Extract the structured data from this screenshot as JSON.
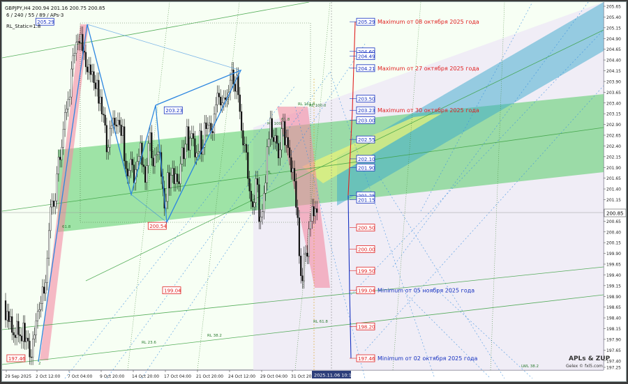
{
  "header": {
    "symbol_line": "GBPJPY,H4  200.94 201.16 200.75 200.85",
    "settings_line": "6 / 240 / 55 / 89 / APs-3",
    "indicator_label": "RL_Static=1.8"
  },
  "watermark": {
    "line1": "APLs & ZUP",
    "line2": "Gelex © fxl5.com"
  },
  "current_price_label": "200.85",
  "current_time_label": "2025.11.06 10:12",
  "colors": {
    "background": "#f7fff4",
    "bull_candle": "#111111",
    "bear_candle": "#111111",
    "green_channel": "#55cc66",
    "blue_channel": "#39aacc",
    "pink_band": "#f48aa4",
    "lavender_zone": "#ece6f6",
    "red_target": "#e02020",
    "blue_target": "#1530c0",
    "pattern_line": "#2c86e0"
  },
  "chart_data": {
    "type": "candlestick",
    "symbol": "GBPJPY",
    "timeframe": "H4",
    "ylim": [
      197.25,
      205.65
    ],
    "y_ticks": [
      "205.65",
      "205.40",
      "205.15",
      "204.90",
      "204.65",
      "204.40",
      "204.15",
      "203.90",
      "203.65",
      "203.40",
      "203.15",
      "202.90",
      "202.65",
      "202.40",
      "202.15",
      "201.90",
      "201.65",
      "201.40",
      "201.15",
      "200.90",
      "200.65",
      "200.40",
      "200.15",
      "199.90",
      "199.65",
      "199.40",
      "199.15",
      "198.90",
      "198.65",
      "198.40",
      "198.15",
      "197.90",
      "197.65",
      "197.40",
      "197.25"
    ],
    "x_ticks": [
      "29 Sep 2025",
      "2 Oct 12:00",
      "7 Oct 04:00",
      "9 Oct 20:00",
      "14 Oct 20:00",
      "17 Oct 04:00",
      "21 Oct 20:00",
      "24 Oct 12:00",
      "29 Oct 04:00",
      "31 Oct 20:00"
    ],
    "ohlc": {
      "open": [
        198.8,
        198.35,
        198.55,
        198.31,
        198.43,
        198.06,
        198.0,
        197.94,
        198.32,
        198.01,
        197.98,
        197.86,
        198.28,
        197.84,
        197.93,
        197.86,
        197.49,
        197.48,
        197.91,
        198.0,
        198.33,
        198.55,
        198.59,
        198.73,
        199.12,
        198.97,
        199.22,
        199.79,
        200.43,
        200.98,
        201.12,
        200.99,
        201.12,
        201.75,
        202.14,
        202.08,
        202.37,
        202.79,
        203.18,
        203.26,
        203.49,
        203.54,
        204.19,
        204.5,
        204.56,
        204.81,
        204.83,
        204.8,
        205.0,
        204.61,
        204.58,
        204.24,
        204.12,
        204.29,
        204.06,
        204.13,
        203.87,
        203.73,
        203.93,
        203.39,
        203.54,
        203.14,
        203.12,
        202.88,
        202.26,
        202.37,
        202.81,
        202.87,
        203.05,
        202.89,
        202.86,
        203.0,
        202.89,
        202.64,
        202.85,
        202.05,
        201.87,
        201.7,
        201.83,
        202.09,
        201.96,
        201.54,
        201.85,
        202.04,
        202.16,
        202.47,
        201.96,
        201.92,
        201.55,
        201.94,
        202.46,
        202.71,
        202.12,
        201.93,
        202.18,
        202.2,
        202.26,
        202.25,
        201.69,
        201.41,
        200.95,
        201.11,
        201.78,
        201.42,
        201.72,
        201.88,
        201.52,
        201.75,
        201.57,
        201.52,
        201.98,
        202.36,
        202.1,
        202.44,
        202.85,
        202.3,
        202.58,
        202.69,
        202.57,
        202.14,
        202.24,
        202.27,
        202.75,
        202.21,
        202.37,
        202.94,
        202.8,
        202.89,
        202.93,
        202.74,
        202.7,
        203.14,
        203.36,
        203.63,
        203.54,
        203.35,
        203.4,
        203.52,
        203.48,
        203.54,
        203.64,
        203.93,
        204.17,
        203.84,
        203.67,
        204.05,
        203.59,
        203.2,
        202.76,
        202.42,
        202.44,
        202.25,
        201.64,
        201.35,
        201.11,
        200.98,
        201.08,
        201.64,
        201.5,
        200.64,
        200.75,
        200.87,
        201.3,
        201.54,
        202.38,
        202.56,
        203.04,
        202.6,
        202.5,
        202.64,
        202.46,
        202.12,
        202.31,
        202.8,
        202.97,
        202.42,
        202.6,
        202.36,
        202.13,
        201.79,
        201.88,
        201.58,
        200.97,
        200.73,
        199.84,
        199.38,
        199.26,
        199.88,
        199.91,
        199.83,
        200.47,
        200.65,
        200.99,
        200.77,
        200.94
      ],
      "close": [
        198.35,
        198.55,
        198.31,
        198.43,
        198.06,
        198.0,
        197.94,
        198.32,
        198.01,
        197.98,
        197.86,
        198.28,
        197.84,
        197.93,
        197.86,
        197.49,
        197.48,
        197.91,
        198.0,
        198.33,
        198.55,
        198.59,
        198.73,
        199.12,
        198.97,
        199.22,
        199.79,
        200.43,
        200.98,
        201.12,
        200.99,
        201.12,
        201.75,
        202.14,
        202.08,
        202.37,
        202.79,
        203.18,
        203.26,
        203.49,
        203.54,
        204.19,
        204.5,
        204.56,
        204.81,
        204.83,
        204.8,
        205.0,
        204.61,
        204.58,
        204.24,
        204.12,
        204.29,
        204.06,
        204.13,
        203.87,
        203.73,
        203.93,
        203.39,
        203.54,
        203.14,
        203.12,
        202.88,
        202.26,
        202.37,
        202.81,
        202.87,
        203.05,
        202.89,
        202.86,
        203.0,
        202.89,
        202.64,
        202.85,
        202.05,
        201.87,
        201.7,
        201.83,
        202.09,
        201.96,
        201.54,
        201.85,
        202.04,
        202.16,
        202.47,
        201.96,
        201.92,
        201.55,
        201.94,
        202.46,
        202.71,
        202.12,
        201.93,
        202.18,
        202.2,
        202.26,
        202.25,
        201.69,
        201.41,
        200.95,
        201.11,
        201.78,
        201.42,
        201.72,
        201.88,
        201.52,
        201.75,
        201.57,
        201.52,
        201.98,
        202.36,
        202.1,
        202.44,
        202.85,
        202.3,
        202.58,
        202.69,
        202.57,
        202.14,
        202.24,
        202.27,
        202.75,
        202.21,
        202.37,
        202.94,
        202.8,
        202.89,
        202.93,
        202.74,
        202.7,
        203.14,
        203.36,
        203.63,
        203.54,
        203.35,
        203.4,
        203.52,
        203.48,
        203.54,
        203.64,
        203.93,
        204.17,
        203.84,
        203.67,
        204.05,
        203.59,
        203.2,
        202.76,
        202.42,
        202.44,
        202.25,
        201.64,
        201.35,
        201.11,
        200.98,
        201.08,
        201.64,
        201.5,
        200.64,
        200.75,
        200.87,
        201.3,
        201.54,
        202.38,
        202.56,
        203.04,
        202.6,
        202.5,
        202.64,
        202.46,
        202.12,
        202.31,
        202.8,
        202.97,
        202.42,
        202.6,
        202.36,
        202.13,
        201.79,
        201.88,
        201.58,
        200.97,
        200.73,
        199.84,
        199.38,
        199.26,
        199.88,
        199.91,
        199.83,
        200.47,
        200.65,
        200.99,
        200.77,
        200.94,
        200.85
      ]
    },
    "wick": 0.18,
    "current_price": 200.85,
    "price_tags": {
      "left": [
        {
          "label": "205.29",
          "value": 205.29,
          "bar": 31,
          "color": "blue"
        },
        {
          "label": "203.23",
          "value": 203.23,
          "bar": 111,
          "color": "blue"
        },
        {
          "label": "200.54",
          "value": 200.54,
          "bar": 101,
          "color": "red"
        },
        {
          "label": "199.04",
          "value": 199.04,
          "bar": 110,
          "color": "red"
        },
        {
          "label": "197.46",
          "value": 197.46,
          "bar": 13,
          "color": "red"
        }
      ],
      "right": [
        {
          "label": "205.29",
          "value": 205.29,
          "color": "blue"
        },
        {
          "label": "204.60",
          "value": 204.6,
          "color": "blue"
        },
        {
          "label": "204.49",
          "value": 204.49,
          "color": "blue"
        },
        {
          "label": "204.21",
          "value": 204.21,
          "color": "blue"
        },
        {
          "label": "203.50",
          "value": 203.5,
          "color": "blue"
        },
        {
          "label": "203.23",
          "value": 203.23,
          "color": "blue"
        },
        {
          "label": "203.00",
          "value": 203.0,
          "color": "blue"
        },
        {
          "label": "202.55",
          "value": 202.55,
          "color": "blue"
        },
        {
          "label": "202.10",
          "value": 202.1,
          "color": "blue"
        },
        {
          "label": "201.90",
          "value": 201.9,
          "color": "blue"
        },
        {
          "label": "201.25",
          "value": 201.25,
          "color": "blue"
        },
        {
          "label": "201.15",
          "value": 201.15,
          "color": "blue"
        },
        {
          "label": "200.50",
          "value": 200.5,
          "color": "red"
        },
        {
          "label": "200.00",
          "value": 200.0,
          "color": "red"
        },
        {
          "label": "199.50",
          "value": 199.5,
          "color": "red"
        },
        {
          "label": "199.04",
          "value": 199.04,
          "color": "red"
        },
        {
          "label": "198.20",
          "value": 198.2,
          "color": "red"
        },
        {
          "label": "197.46",
          "value": 197.46,
          "color": "red"
        }
      ]
    },
    "annotations": [
      {
        "text": "Maximum от 08 октября 2025 года",
        "value": 205.29,
        "color": "red"
      },
      {
        "text": "Maximum от 27 октября 2025 года",
        "value": 204.21,
        "color": "red"
      },
      {
        "text": "Maximum от 30 октября 2025 года",
        "value": 203.23,
        "color": "red"
      },
      {
        "text": "Minimum от 05 ноября 2025 года",
        "value": 199.04,
        "color": "blue"
      },
      {
        "text": "Minimum от 02 октября 2025 года",
        "value": 197.46,
        "color": "blue"
      }
    ],
    "small_labels": [
      "2",
      "61.8",
      "RL 23.6",
      "RL 38.2",
      "RL 61.8",
      "RL 100.0",
      "RL 161.8",
      "LWL 38.2",
      "ML",
      "ML 100.0",
      "61.8",
      "50"
    ],
    "grid": false
  }
}
